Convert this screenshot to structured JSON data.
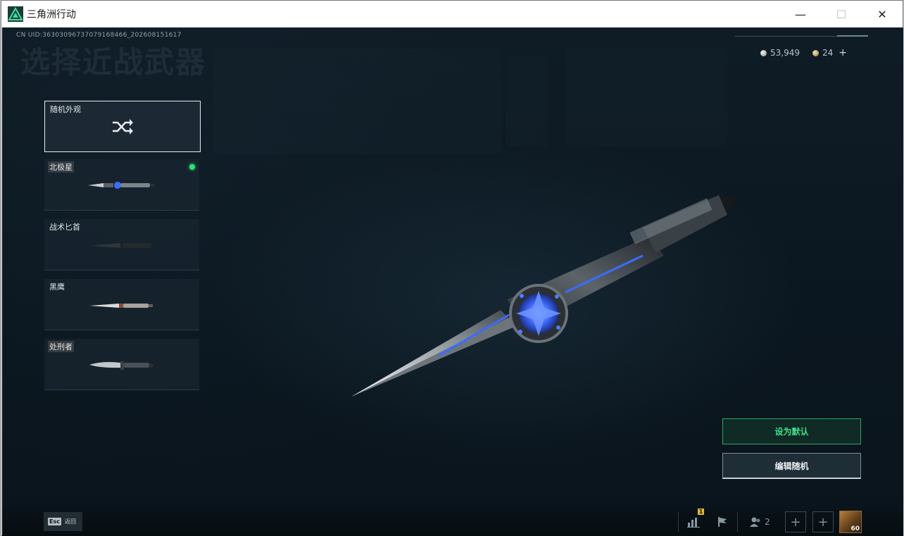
{
  "window": {
    "title": "三角洲行动",
    "minimize_glyph": "—",
    "maximize_glyph": "☐",
    "close_glyph": "✕"
  },
  "header": {
    "uid": "CN UID:36303096737079168466_202608151617",
    "heading": "选择近战武器"
  },
  "currency": {
    "silver_amount": "53,949",
    "gold_amount": "24",
    "plus_glyph": "+"
  },
  "weapons": {
    "random_label": "随机外观",
    "items": [
      {
        "label": "北极星",
        "equipped": true
      },
      {
        "label": "战术匕首",
        "equipped": false
      },
      {
        "label": "黑鹰",
        "equipped": false
      },
      {
        "label": "处刑者",
        "equipped": false
      }
    ]
  },
  "actions": {
    "set_default": "设为默认",
    "edit_random": "编辑随机"
  },
  "bottom_bar": {
    "esc_key": "Esc",
    "esc_label": "返回",
    "stats_badge": "1",
    "friends_count": "2",
    "add_glyph": "+",
    "level": "60"
  },
  "colors": {
    "accent_green": "#2de07a",
    "background": "#0b1720",
    "knife_glow": "#3b6cff"
  },
  "icons": {
    "app": "delta-force-logo-icon",
    "random": "shuffle-icon",
    "stats": "bar-chart-icon",
    "flag": "flag-icon",
    "friends": "friends-icon"
  }
}
